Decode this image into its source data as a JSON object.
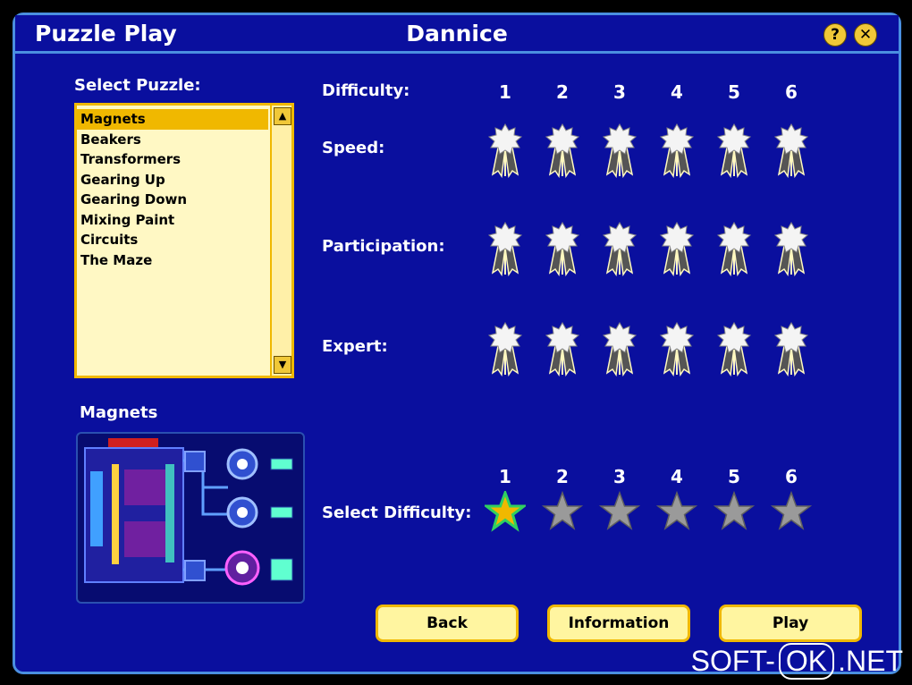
{
  "window": {
    "title": "Puzzle Play",
    "player": "Dannice"
  },
  "titlebar": {
    "help_label": "?",
    "close_label": "✕"
  },
  "select_puzzle": {
    "label": "Select Puzzle:",
    "items": [
      "Magnets",
      "Beakers",
      "Transformers",
      "Gearing Up",
      "Gearing Down",
      "Mixing Paint",
      "Circuits",
      "The Maze"
    ],
    "selected_index": 0
  },
  "preview": {
    "title": "Magnets"
  },
  "difficulty": {
    "label": "Difficulty:",
    "levels": [
      "1",
      "2",
      "3",
      "4",
      "5",
      "6"
    ],
    "rows": [
      "Speed:",
      "Participation:",
      "Expert:"
    ]
  },
  "select_difficulty": {
    "label": "Select Difficulty:",
    "levels": [
      "1",
      "2",
      "3",
      "4",
      "5",
      "6"
    ],
    "selected": 1,
    "selected_color": "#f0b800",
    "unselected_color": "#9a9a9a"
  },
  "buttons": {
    "back": "Back",
    "information": "Information",
    "play": "Play"
  },
  "watermark": {
    "left": "SOFT-",
    "box": "OK",
    "right": ".NET"
  }
}
